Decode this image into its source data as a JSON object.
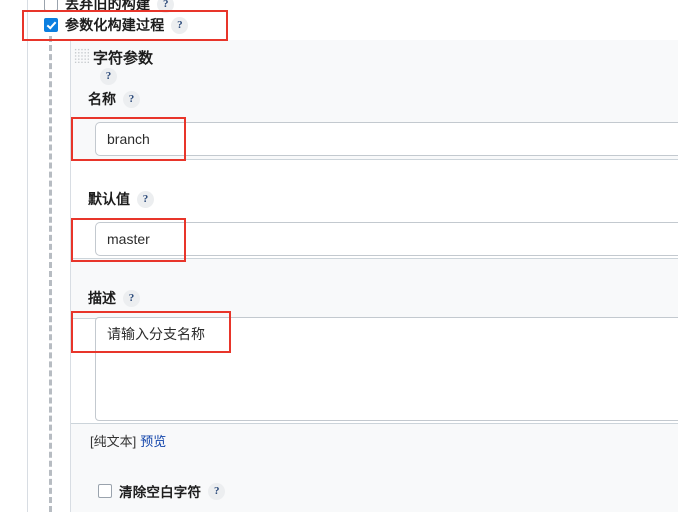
{
  "colors": {
    "accent_checkbox": "#0b7fe0",
    "annotation": "#e8352a",
    "link": "#1144aa",
    "band_bg": "#f8f9fa",
    "divider": "#ccd4da"
  },
  "form": {
    "discard_builds": {
      "label": "丢弃旧的构建",
      "checked": false,
      "help": "?"
    },
    "parameterized_build": {
      "label": "参数化构建过程",
      "checked": true,
      "help": "?"
    },
    "parameter_block": {
      "title": "字符参数",
      "title_help": "?",
      "drag_handle": "drag-handle-icon",
      "fields": {
        "name": {
          "label": "名称",
          "help": "?",
          "value": "branch",
          "placeholder": ""
        },
        "default_value": {
          "label": "默认值",
          "help": "?",
          "value": "master",
          "placeholder": ""
        },
        "description": {
          "label": "描述",
          "help": "?",
          "value": "请输入分支名称",
          "placeholder": ""
        }
      },
      "description_footer": {
        "format": "[纯文本]",
        "preview_link": "预览"
      },
      "trim_whitespace": {
        "label": "清除空白字符",
        "checked": false,
        "help": "?"
      }
    }
  },
  "annotations": [
    {
      "name": "annotation-parameterized-build"
    },
    {
      "name": "annotation-name-field"
    },
    {
      "name": "annotation-default-value-field"
    },
    {
      "name": "annotation-description-field"
    }
  ]
}
